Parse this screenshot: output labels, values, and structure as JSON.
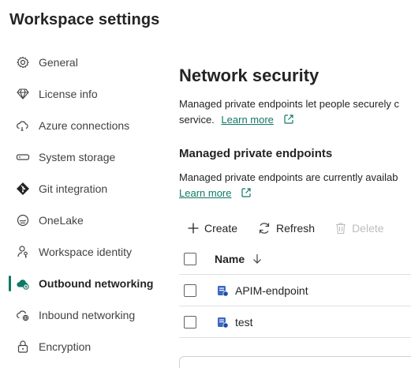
{
  "page": {
    "title": "Workspace settings"
  },
  "nav": {
    "items": [
      {
        "label": "General"
      },
      {
        "label": "License info"
      },
      {
        "label": "Azure connections"
      },
      {
        "label": "System storage"
      },
      {
        "label": "Git integration"
      },
      {
        "label": "OneLake"
      },
      {
        "label": "Workspace identity"
      },
      {
        "label": "Outbound networking"
      },
      {
        "label": "Inbound networking"
      },
      {
        "label": "Encryption"
      }
    ],
    "active_index": 7
  },
  "main": {
    "heading": "Network security",
    "description": "Managed private endpoints let people securely c",
    "description_line2": "service.",
    "learn_more": "Learn more",
    "section_heading": "Managed private endpoints",
    "section_desc": "Managed private endpoints are currently availab",
    "section_learn_more": "Learn more"
  },
  "toolbar": {
    "create": "Create",
    "refresh": "Refresh",
    "delete": "Delete"
  },
  "table": {
    "column_name": "Name",
    "rows": [
      {
        "name": "APIM-endpoint"
      },
      {
        "name": "test"
      }
    ]
  },
  "colors": {
    "accent": "#117865",
    "disabled": "#bdbdbd"
  }
}
